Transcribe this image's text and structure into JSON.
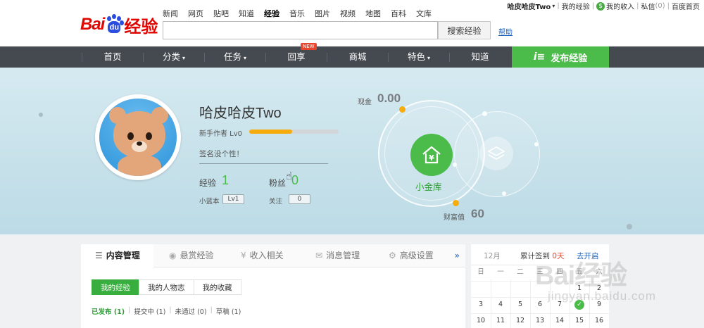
{
  "brand": {
    "logo_text_left": "Bai",
    "logo_text_paw": "du",
    "logo_text_right": "经验"
  },
  "top_nav": [
    {
      "label": "新闻",
      "active": false
    },
    {
      "label": "网页",
      "active": false
    },
    {
      "label": "贴吧",
      "active": false
    },
    {
      "label": "知道",
      "active": false
    },
    {
      "label": "经验",
      "active": true
    },
    {
      "label": "音乐",
      "active": false
    },
    {
      "label": "图片",
      "active": false
    },
    {
      "label": "视频",
      "active": false
    },
    {
      "label": "地图",
      "active": false
    },
    {
      "label": "百科",
      "active": false
    },
    {
      "label": "文库",
      "active": false
    }
  ],
  "search": {
    "value": "",
    "button_label": "搜索经验",
    "help_label": "帮助"
  },
  "user_bar": {
    "username": "哈皮哈皮Two",
    "my_experience": "我的经验",
    "my_income": "我的收入",
    "messages_label": "私信",
    "messages_count": "(0)",
    "homepage": "百度首页"
  },
  "main_nav": {
    "items": [
      {
        "label": "首页",
        "has_caret": false
      },
      {
        "label": "分类",
        "has_caret": true
      },
      {
        "label": "任务",
        "has_caret": true
      },
      {
        "label": "回享",
        "has_caret": false
      },
      {
        "label": "商城",
        "has_caret": false
      },
      {
        "label": "特色",
        "has_caret": true
      },
      {
        "label": "知道",
        "has_caret": false
      }
    ],
    "new_badge": "NEW",
    "publish_label": "发布经验"
  },
  "profile": {
    "name": "哈皮哈皮Two",
    "level_text": "新手作者 Lv0",
    "level_progress": 0.48,
    "signature": "签名没个性！",
    "exp_label": "经验",
    "exp_value": "1",
    "fans_label": "粉丝",
    "fans_value": "0",
    "blue_label": "小蓝本",
    "blue_value": "Lv1",
    "follow_label": "关注",
    "follow_value": "0"
  },
  "wallet": {
    "cash_label": "现金",
    "cash_value": "0.00",
    "vault_label": "小金库",
    "wealth_label": "财富值",
    "wealth_value": "60"
  },
  "content_panel": {
    "tabs": [
      {
        "label": "内容管理",
        "icon": "list-icon",
        "active": true
      },
      {
        "label": "悬赏经验",
        "icon": "coin-icon",
        "active": false
      },
      {
        "label": "收入相关",
        "icon": "yen-icon",
        "active": false
      },
      {
        "label": "消息管理",
        "icon": "mail-icon",
        "active": false
      },
      {
        "label": "高级设置",
        "icon": "gear-icon",
        "active": false
      }
    ],
    "more_label": "»",
    "subtabs": [
      {
        "label": "我的经验",
        "active": true
      },
      {
        "label": "我的人物志",
        "active": false
      },
      {
        "label": "我的收藏",
        "active": false
      }
    ],
    "filters": [
      {
        "label": "已发布",
        "count": "(1)",
        "active": true
      },
      {
        "label": "提交中",
        "count": "(1)",
        "active": false
      },
      {
        "label": "未通过",
        "count": "(0)",
        "active": false
      },
      {
        "label": "草稿",
        "count": "(1)",
        "active": false
      }
    ]
  },
  "calendar": {
    "month": "12月",
    "streak_label": "累计签到",
    "streak_days": "0天",
    "link_label": "去开启",
    "weekdays": [
      "日",
      "一",
      "二",
      "三",
      "四",
      "五",
      "六"
    ],
    "rows": [
      [
        "",
        "",
        "",
        "",
        "",
        "1",
        "2"
      ],
      [
        "3",
        "4",
        "5",
        "6",
        "7",
        "8",
        "9"
      ],
      [
        "10",
        "11",
        "12",
        "13",
        "14",
        "15",
        "16"
      ]
    ],
    "checked_day": "8"
  },
  "watermark": {
    "text": "Bai经验",
    "url": "jingyan.baidu.com"
  },
  "colors": {
    "accent_green": "#4bbb4a",
    "nav_bg": "#454a51",
    "brand_red": "#e10601",
    "progress": "#f6ac0c"
  }
}
